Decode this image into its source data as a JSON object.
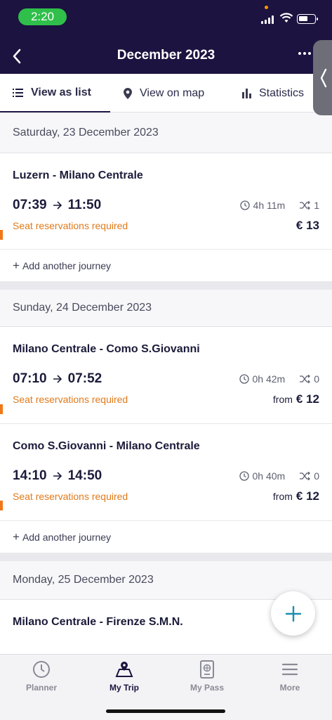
{
  "status_bar": {
    "time": "2:20"
  },
  "header": {
    "title": "December 2023"
  },
  "tabs": [
    {
      "label": "View as list",
      "icon": "list-icon"
    },
    {
      "label": "View on map",
      "icon": "map-pin-icon"
    },
    {
      "label": "Statistics",
      "icon": "bar-chart-icon"
    }
  ],
  "days": [
    {
      "date": "Saturday, 23 December 2023",
      "journeys": [
        {
          "route": "Luzern - Milano Centrale",
          "depart": "07:39",
          "arrive": "11:50",
          "duration": "4h 11m",
          "changes": "1",
          "notice": "Seat reservations required",
          "price_prefix": "",
          "price": "€ 13"
        }
      ],
      "add_label": "Add another journey"
    },
    {
      "date": "Sunday, 24 December 2023",
      "journeys": [
        {
          "route": "Milano Centrale - Como S.Giovanni",
          "depart": "07:10",
          "arrive": "07:52",
          "duration": "0h 42m",
          "changes": "0",
          "notice": "Seat reservations required",
          "price_prefix": "from",
          "price": "€ 12"
        },
        {
          "route": "Como S.Giovanni - Milano Centrale",
          "depart": "14:10",
          "arrive": "14:50",
          "duration": "0h 40m",
          "changes": "0",
          "notice": "Seat reservations required",
          "price_prefix": "from",
          "price": "€ 12"
        }
      ],
      "add_label": "Add another journey"
    },
    {
      "date": "Monday, 25 December 2023",
      "journeys": [
        {
          "route": "Milano Centrale - Firenze S.M.N."
        }
      ]
    }
  ],
  "bottom_nav": [
    {
      "label": "Planner",
      "icon": "clock-icon"
    },
    {
      "label": "My Trip",
      "icon": "map-icon"
    },
    {
      "label": "My Pass",
      "icon": "passport-icon"
    },
    {
      "label": "More",
      "icon": "menu-icon"
    }
  ],
  "colors": {
    "header_bg": "#1c1340",
    "warning": "#e07a1a",
    "accent_fab": "#1a8fb0"
  }
}
